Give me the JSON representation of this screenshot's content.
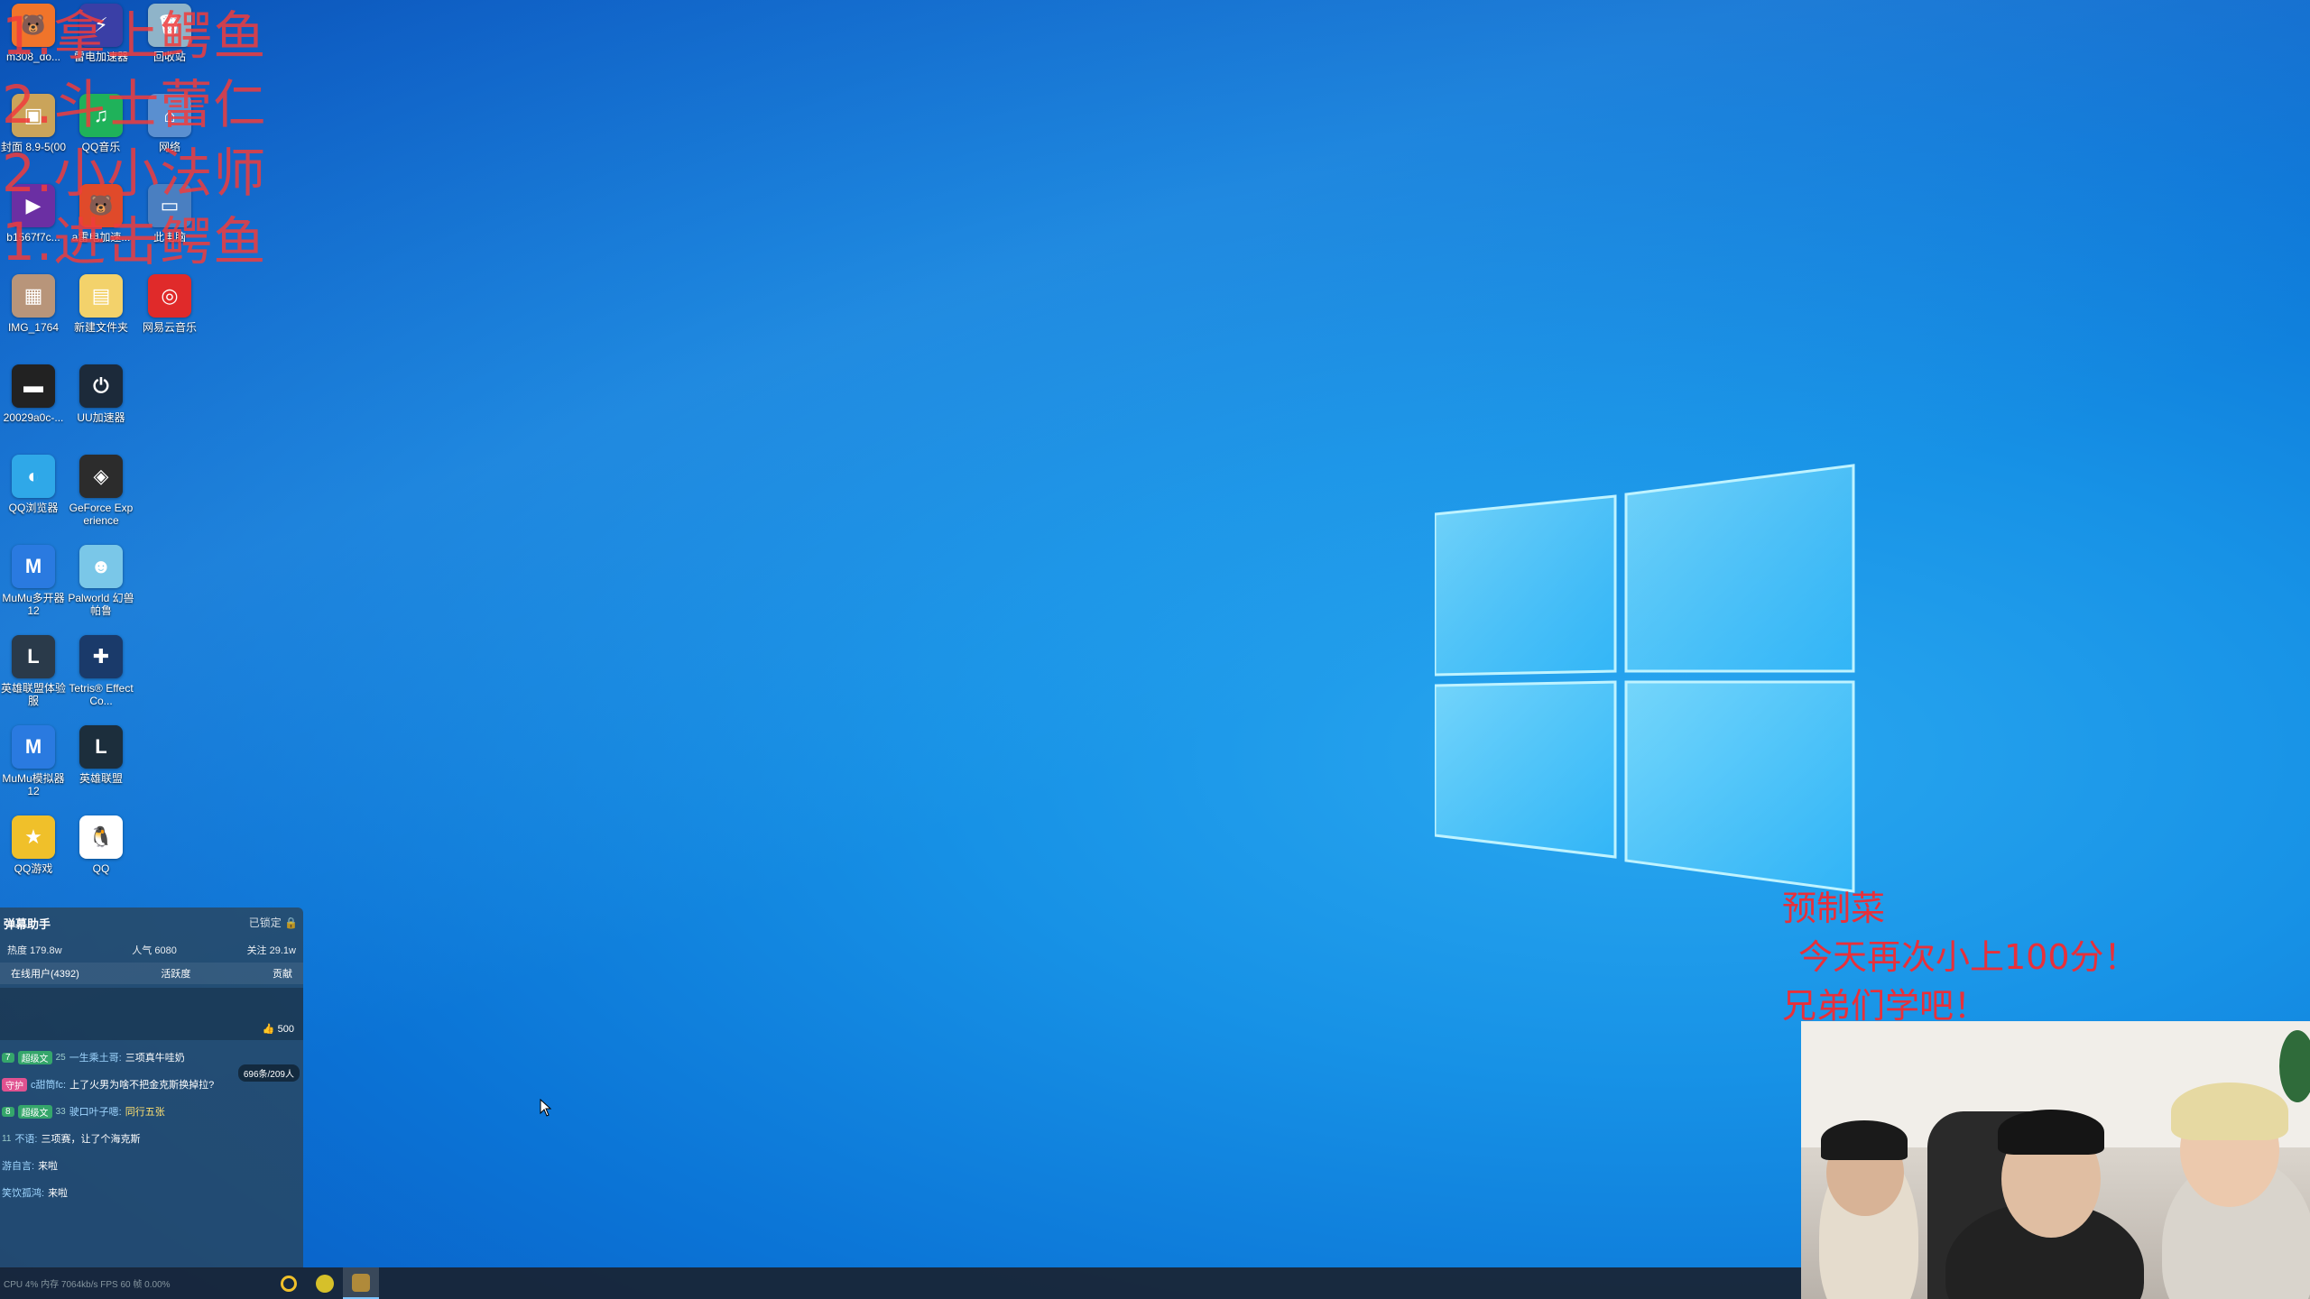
{
  "desktop": {
    "icons": [
      {
        "label": "m308_do...",
        "name": "m308-icon",
        "color": "#f0742a",
        "glyph": "🐻"
      },
      {
        "label": "雷电加速器",
        "name": "leidian-accelerator-icon",
        "color": "#3a3fa6",
        "glyph": "⚡"
      },
      {
        "label": "回收站",
        "name": "recycle-bin-icon",
        "color": "#8fb4c9",
        "glyph": "🗑"
      },
      {
        "label": "封面 8.9-5(00",
        "name": "cover-image-icon",
        "color": "#caa45a",
        "glyph": "▣"
      },
      {
        "label": "QQ音乐",
        "name": "qq-music-icon",
        "color": "#1fb25a",
        "glyph": "♫"
      },
      {
        "label": "网络",
        "name": "network-icon",
        "color": "#5a8fd0",
        "glyph": "⌂"
      },
      {
        "label": "b1567f7c...",
        "name": "video-file-icon",
        "color": "#6b2fa3",
        "glyph": "▶"
      },
      {
        "label": "a雷电加速...",
        "name": "accelerator-shortcut-icon",
        "color": "#e04a2a",
        "glyph": "🐻"
      },
      {
        "label": "此电脑",
        "name": "this-pc-icon",
        "color": "#4a7fc1",
        "glyph": "▭"
      },
      {
        "label": "IMG_1764",
        "name": "img-file-icon",
        "color": "#b8957a",
        "glyph": "▦"
      },
      {
        "label": "新建文件夹",
        "name": "new-folder-icon",
        "color": "#f3d26b",
        "glyph": "▤"
      },
      {
        "label": "网易云音乐",
        "name": "netease-music-icon",
        "color": "#e02a2a",
        "glyph": "◎"
      },
      {
        "label": "20029a0c-...",
        "name": "media-file-icon",
        "color": "#222222",
        "glyph": "▬"
      },
      {
        "label": "UU加速器",
        "name": "uu-accelerator-icon",
        "color": "#1c2a3a",
        "glyph": "⏻"
      },
      {
        "label": "QQ浏览器",
        "name": "qq-browser-icon",
        "color": "#2fa8e8",
        "glyph": "◐"
      },
      {
        "label": "GeForce Experience",
        "name": "geforce-icon",
        "color": "#2c2c2c",
        "glyph": "◈"
      },
      {
        "label": "MuMu多开器12",
        "name": "mumu-multi-icon",
        "color": "#2a7ae0",
        "glyph": "M"
      },
      {
        "label": "Palworld 幻兽帕鲁",
        "name": "palworld-icon",
        "color": "#7ac7e8",
        "glyph": "☻"
      },
      {
        "label": "英雄联盟体验服",
        "name": "lol-pbe-icon",
        "color": "#2a3a4a",
        "glyph": "L"
      },
      {
        "label": "Tetris® Effect Co...",
        "name": "tetris-icon",
        "color": "#1a3a6a",
        "glyph": "✚"
      },
      {
        "label": "MuMu模拟器12",
        "name": "mumu-emulator-icon",
        "color": "#2a7ae0",
        "glyph": "M"
      },
      {
        "label": "英雄联盟",
        "name": "lol-icon",
        "color": "#1c2e3c",
        "glyph": "L"
      },
      {
        "label": "QQ游戏",
        "name": "qq-game-icon",
        "color": "#f0c02a",
        "glyph": "★"
      },
      {
        "label": "QQ",
        "name": "qq-icon",
        "color": "#ffffff",
        "glyph": "🐧"
      }
    ]
  },
  "overlay_left": [
    "1.拿上鳄鱼",
    "2.斗士蕾仁",
    "2.小小法师",
    "1.进击鳄鱼"
  ],
  "overlay_right": [
    "预制菜",
    "今天再次小上100分！",
    "兄弟们学吧！"
  ],
  "danmu": {
    "title": "弹幕助手",
    "locked": "已锁定",
    "heat": "热度 179.8w",
    "popularity": "人气 6080",
    "follow": "关注 29.1w",
    "online": "在线用户(4392)",
    "active": "活跃度",
    "tab_right": "贡献",
    "likes": "500",
    "msg_count": "696条/209人",
    "messages": [
      {
        "level": "7",
        "badge": "超级文",
        "fans": "25",
        "name": "一生乘土哥:",
        "text": "三项真牛哇奶"
      },
      {
        "level": "",
        "badge": "守护",
        "fans": "",
        "name": "c甜筒fc:",
        "text": "上了火男为啥不把金克斯换掉拉?"
      },
      {
        "level": "8",
        "badge": "超级文",
        "fans": "33",
        "name": "驶口叶子嗯:",
        "text": "同行五张"
      },
      {
        "level": "",
        "badge": "",
        "fans": "11",
        "name": "不语:",
        "text": "三项赛，让了个海克斯"
      },
      {
        "level": "",
        "badge": "",
        "fans": "",
        "name": "游自言:",
        "text": "来啦"
      },
      {
        "level": "",
        "badge": "",
        "fans": "",
        "name": "笑饮孤鸿:",
        "text": "来啦"
      }
    ]
  },
  "taskbar": {
    "status": "CPU 4%  内存 7064kb/s  FPS 60  帧 0.00%"
  },
  "colors": {
    "overlay_red": "#e8303a",
    "wallpaper_blue": "#1792e6"
  }
}
